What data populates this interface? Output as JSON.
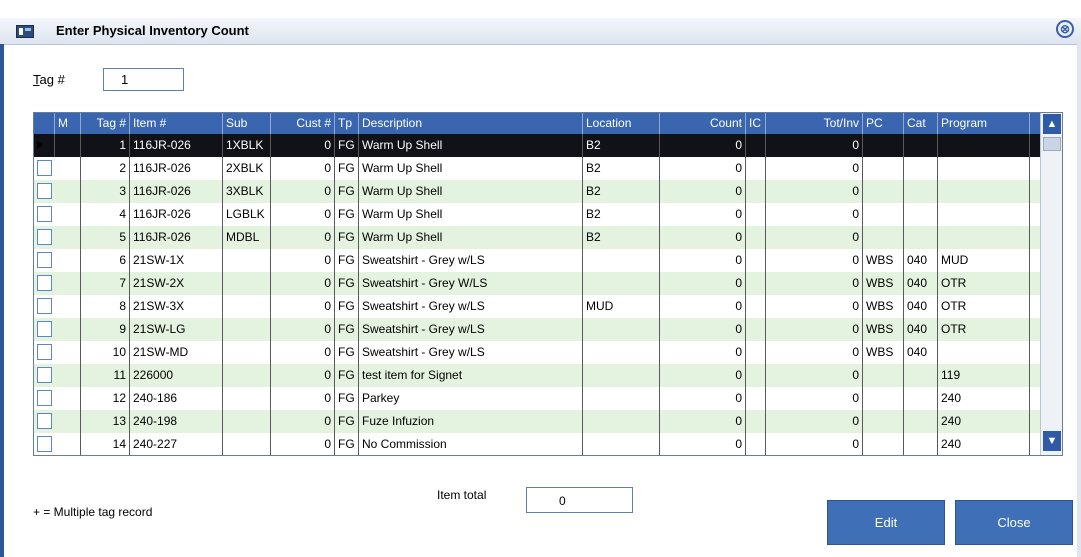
{
  "window": {
    "title": "Enter Physical Inventory Count",
    "close_symbol": "⊗"
  },
  "tag": {
    "label": "Tag #",
    "value": "1"
  },
  "grid": {
    "columns": [
      "",
      "M",
      "Tag #",
      "Item #",
      "Sub",
      "Cust #",
      "Tp",
      "Description",
      "Location",
      "Count",
      "IC",
      "Tot/Inv",
      "PC",
      "Cat",
      "Program"
    ],
    "rows": [
      {
        "m": "",
        "tag": "1",
        "item": "116JR-026",
        "sub": "1XBLK",
        "cust": "0",
        "tp": "FG",
        "desc": "Warm Up Shell",
        "loc": "B2",
        "count": "0",
        "ic": "",
        "tot": "0",
        "pc": "",
        "cat": "",
        "prog": "",
        "selected": true
      },
      {
        "m": "",
        "tag": "2",
        "item": "116JR-026",
        "sub": "2XBLK",
        "cust": "0",
        "tp": "FG",
        "desc": "Warm Up Shell",
        "loc": "B2",
        "count": "0",
        "ic": "",
        "tot": "0",
        "pc": "",
        "cat": "",
        "prog": ""
      },
      {
        "m": "",
        "tag": "3",
        "item": "116JR-026",
        "sub": "3XBLK",
        "cust": "0",
        "tp": "FG",
        "desc": "Warm Up Shell",
        "loc": "B2",
        "count": "0",
        "ic": "",
        "tot": "0",
        "pc": "",
        "cat": "",
        "prog": ""
      },
      {
        "m": "",
        "tag": "4",
        "item": "116JR-026",
        "sub": "LGBLK",
        "cust": "0",
        "tp": "FG",
        "desc": "Warm Up Shell",
        "loc": "B2",
        "count": "0",
        "ic": "",
        "tot": "0",
        "pc": "",
        "cat": "",
        "prog": ""
      },
      {
        "m": "",
        "tag": "5",
        "item": "116JR-026",
        "sub": "MDBL",
        "cust": "0",
        "tp": "FG",
        "desc": "Warm Up Shell",
        "loc": "B2",
        "count": "0",
        "ic": "",
        "tot": "0",
        "pc": "",
        "cat": "",
        "prog": ""
      },
      {
        "m": "",
        "tag": "6",
        "item": "21SW-1X",
        "sub": "",
        "cust": "0",
        "tp": "FG",
        "desc": "Sweatshirt - Grey w/LS",
        "loc": "",
        "count": "0",
        "ic": "",
        "tot": "0",
        "pc": "WBS",
        "cat": "040",
        "prog": "MUD"
      },
      {
        "m": "",
        "tag": "7",
        "item": "21SW-2X",
        "sub": "",
        "cust": "0",
        "tp": "FG",
        "desc": "Sweatshirt - Grey W/LS",
        "loc": "",
        "count": "0",
        "ic": "",
        "tot": "0",
        "pc": "WBS",
        "cat": "040",
        "prog": "OTR"
      },
      {
        "m": "",
        "tag": "8",
        "item": "21SW-3X",
        "sub": "",
        "cust": "0",
        "tp": "FG",
        "desc": "Sweatshirt - Grey w/LS",
        "loc": "MUD",
        "count": "0",
        "ic": "",
        "tot": "0",
        "pc": "WBS",
        "cat": "040",
        "prog": "OTR"
      },
      {
        "m": "",
        "tag": "9",
        "item": "21SW-LG",
        "sub": "",
        "cust": "0",
        "tp": "FG",
        "desc": "Sweatshirt - Grey w/LS",
        "loc": "",
        "count": "0",
        "ic": "",
        "tot": "0",
        "pc": "WBS",
        "cat": "040",
        "prog": "OTR"
      },
      {
        "m": "",
        "tag": "10",
        "item": "21SW-MD",
        "sub": "",
        "cust": "0",
        "tp": "FG",
        "desc": "Sweatshirt - Grey w/LS",
        "loc": "",
        "count": "0",
        "ic": "",
        "tot": "0",
        "pc": "WBS",
        "cat": "040",
        "prog": ""
      },
      {
        "m": "",
        "tag": "11",
        "item": "226000",
        "sub": "",
        "cust": "0",
        "tp": "FG",
        "desc": "test item for Signet",
        "loc": "",
        "count": "0",
        "ic": "",
        "tot": "0",
        "pc": "",
        "cat": "",
        "prog": "119"
      },
      {
        "m": "",
        "tag": "12",
        "item": "240-186",
        "sub": "",
        "cust": "0",
        "tp": "FG",
        "desc": "Parkey",
        "loc": "",
        "count": "0",
        "ic": "",
        "tot": "0",
        "pc": "",
        "cat": "",
        "prog": "240"
      },
      {
        "m": "",
        "tag": "13",
        "item": "240-198",
        "sub": "",
        "cust": "0",
        "tp": "FG",
        "desc": "Fuze Infuzion",
        "loc": "",
        "count": "0",
        "ic": "",
        "tot": "0",
        "pc": "",
        "cat": "",
        "prog": "240"
      },
      {
        "m": "",
        "tag": "14",
        "item": "240-227",
        "sub": "",
        "cust": "0",
        "tp": "FG",
        "desc": "No Commission",
        "loc": "",
        "count": "0",
        "ic": "",
        "tot": "0",
        "pc": "",
        "cat": "",
        "prog": "240"
      }
    ]
  },
  "footer": {
    "note": "+ = Multiple tag record",
    "item_total_label": "Item total",
    "item_total_value": "0",
    "edit_label": "Edit",
    "close_label": "Close"
  },
  "colors": {
    "header_blue": "#3a66b0",
    "row_green": "#e3f3df",
    "selected_row": "#111118",
    "button_blue": "#3e6fb7"
  }
}
